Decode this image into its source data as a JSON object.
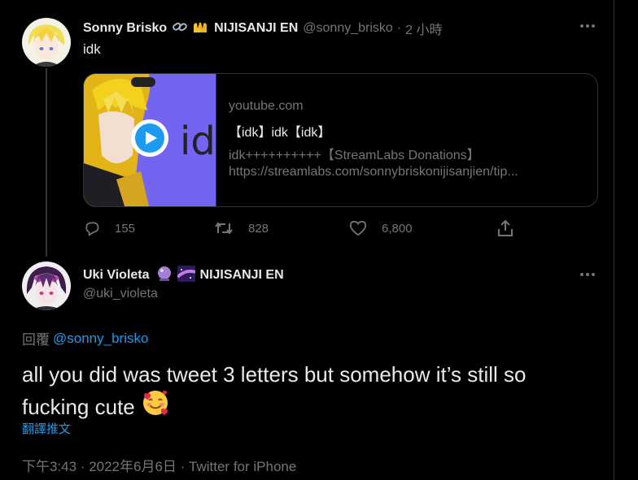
{
  "tweet1": {
    "display_name": "Sonny Brisko",
    "affiliation": "NIJISANJI EN",
    "handle": "@sonny_brisko",
    "separator": "·",
    "time": "2 小時",
    "text": "idk",
    "card": {
      "thumb_text": "idk",
      "domain": "youtube.com",
      "title": "【idk】idk【idk】",
      "description": "idk++++++++++【StreamLabs Donations】",
      "url": "https://streamlabs.com/sonnybriskonijisanjien/tip..."
    },
    "replies": "155",
    "retweets": "828",
    "likes": "6,800"
  },
  "tweet2": {
    "display_name": "Uki Violeta",
    "affiliation": "NIJISANJI EN",
    "handle": "@uki_violeta",
    "reply_label": "回覆",
    "reply_to": "@sonny_brisko",
    "text_line1": "all you did was tweet 3 letters but somehow it’s still so",
    "text_line2": "fucking cute",
    "translate": "翻譯推文",
    "timestamp": "下午3:43 · 2022年6月6日 · Twitter for iPhone"
  },
  "colors": {
    "accent": "#1d9bf0",
    "muted": "#71767b",
    "text": "#e7e9ea",
    "border": "#2f3336"
  },
  "icons": [
    "link-icon",
    "hands-icon",
    "crystal-ball-icon",
    "milky-way-icon",
    "play-icon",
    "reply-icon",
    "retweet-icon",
    "like-icon",
    "share-icon",
    "more-icon",
    "smiling-hearts-emoji"
  ]
}
